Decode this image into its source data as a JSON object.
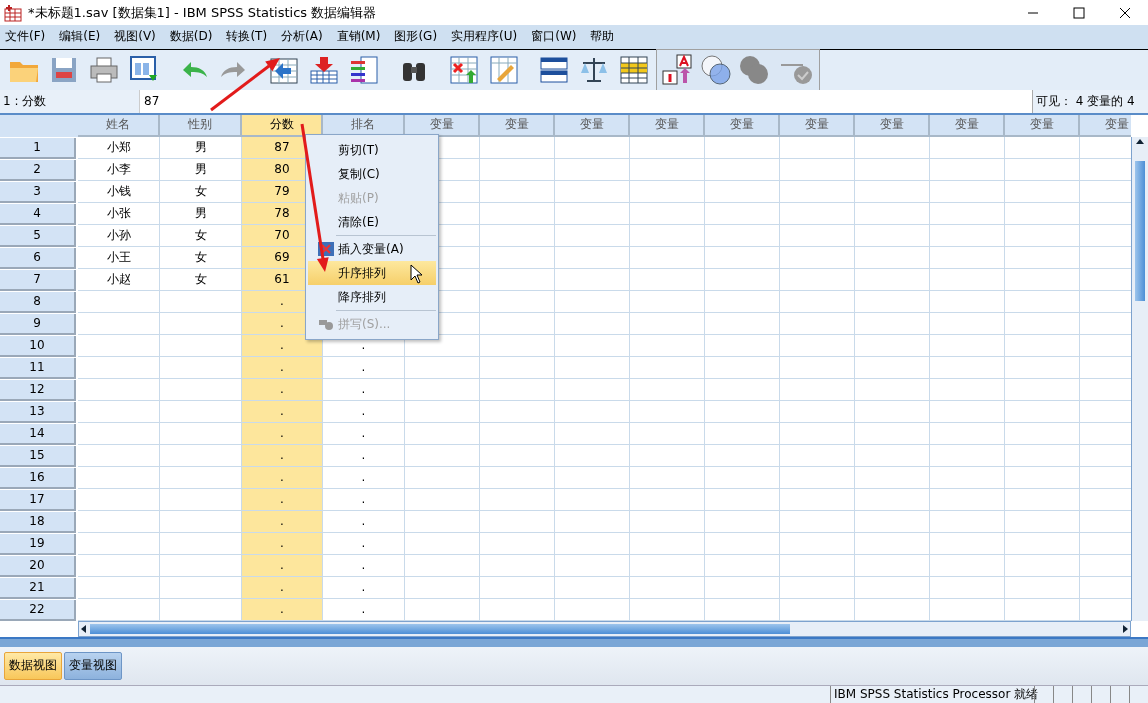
{
  "window": {
    "title": "*未标题1.sav [数据集1] - IBM SPSS Statistics 数据编辑器"
  },
  "menu": [
    "文件(F)",
    "编辑(E)",
    "视图(V)",
    "数据(D)",
    "转换(T)",
    "分析(A)",
    "直销(M)",
    "图形(G)",
    "实用程序(U)",
    "窗口(W)",
    "帮助"
  ],
  "cell_editor": {
    "cell": "1 : 分数",
    "value": "87",
    "visible": "可见： 4 变量的 4"
  },
  "table": {
    "columns": [
      {
        "label": "姓名",
        "selected": false
      },
      {
        "label": "性别",
        "selected": false
      },
      {
        "label": "分数",
        "selected": true
      },
      {
        "label": "排名",
        "selected": false
      },
      {
        "label": "变量",
        "selected": false
      },
      {
        "label": "变量",
        "selected": false
      },
      {
        "label": "变量",
        "selected": false
      },
      {
        "label": "变量",
        "selected": false
      },
      {
        "label": "变量",
        "selected": false
      },
      {
        "label": "变量",
        "selected": false
      },
      {
        "label": "变量",
        "selected": false
      },
      {
        "label": "变量",
        "selected": false
      },
      {
        "label": "变量",
        "selected": false
      },
      {
        "label": "变量",
        "selected": false
      }
    ],
    "rows": [
      {
        "number": "1",
        "cells": [
          "小郑",
          "男",
          "87",
          null
        ]
      },
      {
        "number": "2",
        "cells": [
          "小李",
          "男",
          "80",
          null
        ]
      },
      {
        "number": "3",
        "cells": [
          "小钱",
          "女",
          "79",
          null
        ]
      },
      {
        "number": "4",
        "cells": [
          "小张",
          "男",
          "78",
          null
        ]
      },
      {
        "number": "5",
        "cells": [
          "小孙",
          "女",
          "70",
          null
        ]
      },
      {
        "number": "6",
        "cells": [
          "小王",
          "女",
          "69",
          null
        ]
      },
      {
        "number": "7",
        "cells": [
          "小赵",
          "女",
          "61",
          null
        ]
      },
      {
        "number": "8",
        "cells": [
          null,
          null,
          ".",
          null
        ]
      },
      {
        "number": "9",
        "cells": [
          null,
          null,
          ".",
          null
        ]
      },
      {
        "number": "10",
        "cells": [
          null,
          null,
          ".",
          "."
        ]
      },
      {
        "number": "11",
        "cells": [
          null,
          null,
          ".",
          "."
        ]
      },
      {
        "number": "12",
        "cells": [
          null,
          null,
          ".",
          "."
        ]
      },
      {
        "number": "13",
        "cells": [
          null,
          null,
          ".",
          "."
        ]
      },
      {
        "number": "14",
        "cells": [
          null,
          null,
          ".",
          "."
        ]
      },
      {
        "number": "15",
        "cells": [
          null,
          null,
          ".",
          "."
        ]
      },
      {
        "number": "16",
        "cells": [
          null,
          null,
          ".",
          "."
        ]
      },
      {
        "number": "17",
        "cells": [
          null,
          null,
          ".",
          "."
        ]
      },
      {
        "number": "18",
        "cells": [
          null,
          null,
          ".",
          "."
        ]
      },
      {
        "number": "19",
        "cells": [
          null,
          null,
          ".",
          "."
        ]
      },
      {
        "number": "20",
        "cells": [
          null,
          null,
          ".",
          "."
        ]
      },
      {
        "number": "21",
        "cells": [
          null,
          null,
          ".",
          "."
        ]
      },
      {
        "number": "22",
        "cells": [
          null,
          null,
          ".",
          "."
        ]
      }
    ]
  },
  "context_menu": [
    {
      "kind": "item",
      "label": "剪切(T)",
      "disabled": false,
      "selected": false
    },
    {
      "kind": "item",
      "label": "复制(C)",
      "disabled": false,
      "selected": false
    },
    {
      "kind": "item",
      "label": "粘贴(P)",
      "disabled": true,
      "selected": false
    },
    {
      "kind": "item",
      "label": "清除(E)",
      "disabled": false,
      "selected": false
    },
    {
      "kind": "separator"
    },
    {
      "kind": "item",
      "label": "插入变量(A)",
      "disabled": false,
      "selected": false,
      "has_icon": true
    },
    {
      "kind": "item",
      "label": "升序排列",
      "disabled": false,
      "selected": true
    },
    {
      "kind": "item",
      "label": "降序排列",
      "disabled": false,
      "selected": false
    },
    {
      "kind": "separator"
    },
    {
      "kind": "item",
      "label": "拼写(S)...",
      "disabled": true,
      "selected": false,
      "has_icon": true
    }
  ],
  "view_tabs": [
    {
      "label": "数据视图",
      "selected": true
    },
    {
      "label": "变量视图",
      "selected": false
    }
  ],
  "status_bar": {
    "text": "IBM SPSS Statistics Processor 就绪"
  }
}
